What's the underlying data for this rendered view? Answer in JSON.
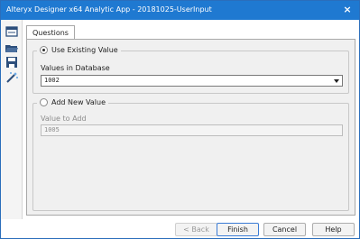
{
  "window": {
    "title": "Alteryx Designer x64 Analytic App - 20181025-UserInput",
    "close_label": "×"
  },
  "tab": {
    "label": "Questions"
  },
  "existing": {
    "option_label": "Use Existing Value",
    "field_label": "Values in Database",
    "selected_value": "1002"
  },
  "new_value": {
    "option_label": "Add New Value",
    "field_label": "Value to Add",
    "value": "1005"
  },
  "buttons": {
    "back": "< Back",
    "finish": "Finish",
    "cancel": "Cancel",
    "help": "Help"
  },
  "colors": {
    "titlebar": "#1f79d1",
    "accent": "#3a7bd5"
  }
}
